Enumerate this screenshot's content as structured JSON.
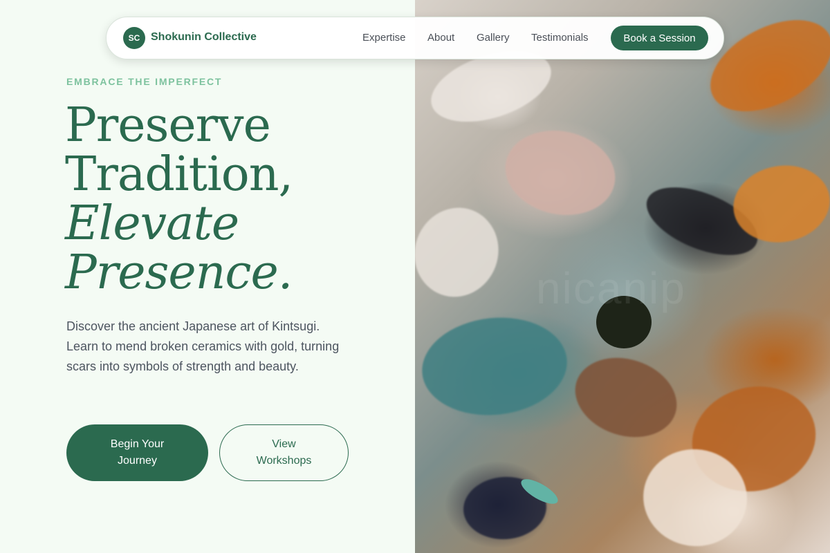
{
  "nav": {
    "logo_initials": "SC",
    "brand_name": "Shokunin Collective",
    "links": [
      "Expertise",
      "About",
      "Gallery",
      "Testimonials"
    ],
    "cta_label": "Book a Session"
  },
  "hero": {
    "eyebrow": "EMBRACE THE IMPERFECT",
    "headline_line1": "Preserve",
    "headline_line2": "Tradition,",
    "headline_line3": "Elevate",
    "headline_line4": "Presence.",
    "description": "Discover the ancient Japanese art of Kintsugi. Learn to mend broken ceramics with gold, turning scars into symbols of strength and beauty.",
    "primary_button": "Begin Your Journey",
    "secondary_button": "View Workshops"
  },
  "image": {
    "watermark_text": "nicanip"
  },
  "colors": {
    "primary": "#2b6a4f",
    "eyebrow": "#7dc29e",
    "background": "#f4fbf4",
    "body_text": "#4d5560"
  }
}
